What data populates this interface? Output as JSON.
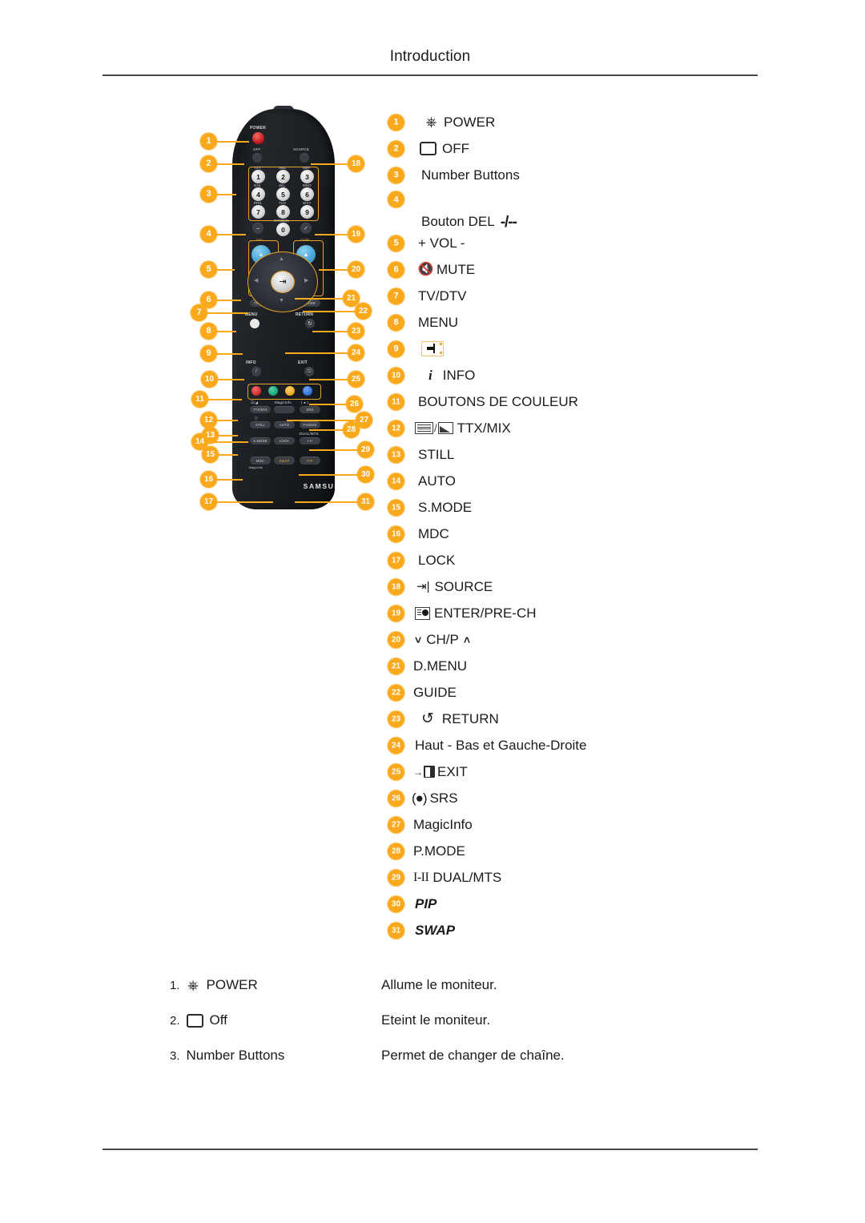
{
  "header": {
    "title": "Introduction"
  },
  "remote": {
    "brand": "SAMSUNG",
    "labels": {
      "power": "POWER",
      "off": "OFF",
      "source": "SOURCE",
      "vol": "VOL",
      "mute": "MUTE",
      "chp": "CH/P",
      "tvdtv": "TV/DTV",
      "dmenu": "D.MENU",
      "guide": "GUIDE",
      "menu": "MENU",
      "return": "RETURN",
      "info": "INFO",
      "exit": "EXIT",
      "ttx_mix": "TTX/MIX",
      "magicinfo": "MagicInfo",
      "srs": "SRS",
      "still": "STILL",
      "auto": "AUTO",
      "pmode": "P.MODE",
      "smode": "S.MODE",
      "lock": "LOCK",
      "dualmts": "DUAL/MTS",
      "dual_glyph": "I-II",
      "mdc": "MDC",
      "mdc_sub": "MagicInfo",
      "swap": "SWAP",
      "pip": "PIP",
      "minus": "−"
    },
    "number_keys": [
      "1",
      "2",
      "3",
      "4",
      "5",
      "6",
      "7",
      "8",
      "9",
      "0"
    ],
    "number_sub": [
      "TXT",
      "ABC",
      "DEF",
      "GHI",
      "JKL",
      "MNO",
      "PRS",
      "TUV",
      "WXY",
      "SYMBOL"
    ],
    "color_buttons": [
      {
        "name": "red-color-button",
        "color": "#d42b2b"
      },
      {
        "name": "green-color-button",
        "color": "#17a278"
      },
      {
        "name": "yellow-color-button",
        "color": "#e8a41c"
      },
      {
        "name": "blue-color-button",
        "color": "#2d6ed1"
      }
    ],
    "callouts_left": [
      "1",
      "2",
      "3",
      "4",
      "5",
      "6",
      "7",
      "8",
      "9",
      "10",
      "11",
      "12",
      "13",
      "14",
      "15",
      "16",
      "17"
    ],
    "callouts_right": [
      "18",
      "19",
      "20",
      "21",
      "22",
      "23",
      "24",
      "25",
      "26",
      "27",
      "28",
      "29",
      "30",
      "31"
    ]
  },
  "legend": [
    {
      "num": "1",
      "icon": "power-icon",
      "label": "POWER"
    },
    {
      "num": "2",
      "icon": "off-icon",
      "label": "OFF"
    },
    {
      "num": "3",
      "icon": "",
      "label": "Number Buttons"
    },
    {
      "num": "4",
      "icon": "del-icon",
      "label": "Bouton DEL"
    },
    {
      "num": "5",
      "icon": "",
      "label": "+ VOL -"
    },
    {
      "num": "6",
      "icon": "mute-icon",
      "label": "MUTE"
    },
    {
      "num": "7",
      "icon": "",
      "label": "TV/DTV"
    },
    {
      "num": "8",
      "icon": "",
      "label": "MENU"
    },
    {
      "num": "9",
      "icon": "enter-marker-icon",
      "label": ""
    },
    {
      "num": "10",
      "icon": "info-icon",
      "label": "INFO"
    },
    {
      "num": "11",
      "icon": "",
      "label": "BOUTONS DE COULEUR"
    },
    {
      "num": "12",
      "icon": "ttx-mix-icon",
      "label": "TTX/MIX"
    },
    {
      "num": "13",
      "icon": "",
      "label": "STILL"
    },
    {
      "num": "14",
      "icon": "",
      "label": "AUTO"
    },
    {
      "num": "15",
      "icon": "",
      "label": "S.MODE"
    },
    {
      "num": "16",
      "icon": "",
      "label": "MDC"
    },
    {
      "num": "17",
      "icon": "",
      "label": "LOCK"
    },
    {
      "num": "18",
      "icon": "source-icon",
      "label": "SOURCE"
    },
    {
      "num": "19",
      "icon": "enter-prech-icon",
      "label": "ENTER/PRE-CH"
    },
    {
      "num": "20",
      "icon": "chevron-down-icon",
      "label": "CH/P",
      "icon_after": "chevron-up-icon"
    },
    {
      "num": "21",
      "icon": "",
      "label": "D.MENU"
    },
    {
      "num": "22",
      "icon": "",
      "label": "GUIDE"
    },
    {
      "num": "23",
      "icon": "return-icon",
      "label": "RETURN"
    },
    {
      "num": "24",
      "icon": "",
      "label": "Haut - Bas et Gauche-Droite"
    },
    {
      "num": "25",
      "icon": "exit-icon",
      "label": "EXIT"
    },
    {
      "num": "26",
      "icon": "srs-icon",
      "label": "SRS"
    },
    {
      "num": "27",
      "icon": "",
      "label": "MagicInfo"
    },
    {
      "num": "28",
      "icon": "",
      "label": "P.MODE"
    },
    {
      "num": "29",
      "icon": "dual-mts-icon",
      "label": "DUAL/MTS"
    },
    {
      "num": "30",
      "icon": "",
      "label": "PIP",
      "italic": true
    },
    {
      "num": "31",
      "icon": "",
      "label": "SWAP",
      "italic": true
    }
  ],
  "description_table": [
    {
      "num": "1.",
      "icon": "power-icon",
      "key": "POWER",
      "value": "Allume le moniteur."
    },
    {
      "num": "2.",
      "icon": "off-icon",
      "key": "Off",
      "value": "Eteint le moniteur."
    },
    {
      "num": "3.",
      "icon": "",
      "key": "Number Buttons",
      "value": "Permet de changer de chaîne."
    }
  ],
  "colors": {
    "badge": "#f9a91b",
    "rule": "#4a4a4a",
    "text": "#1b1b1b"
  }
}
